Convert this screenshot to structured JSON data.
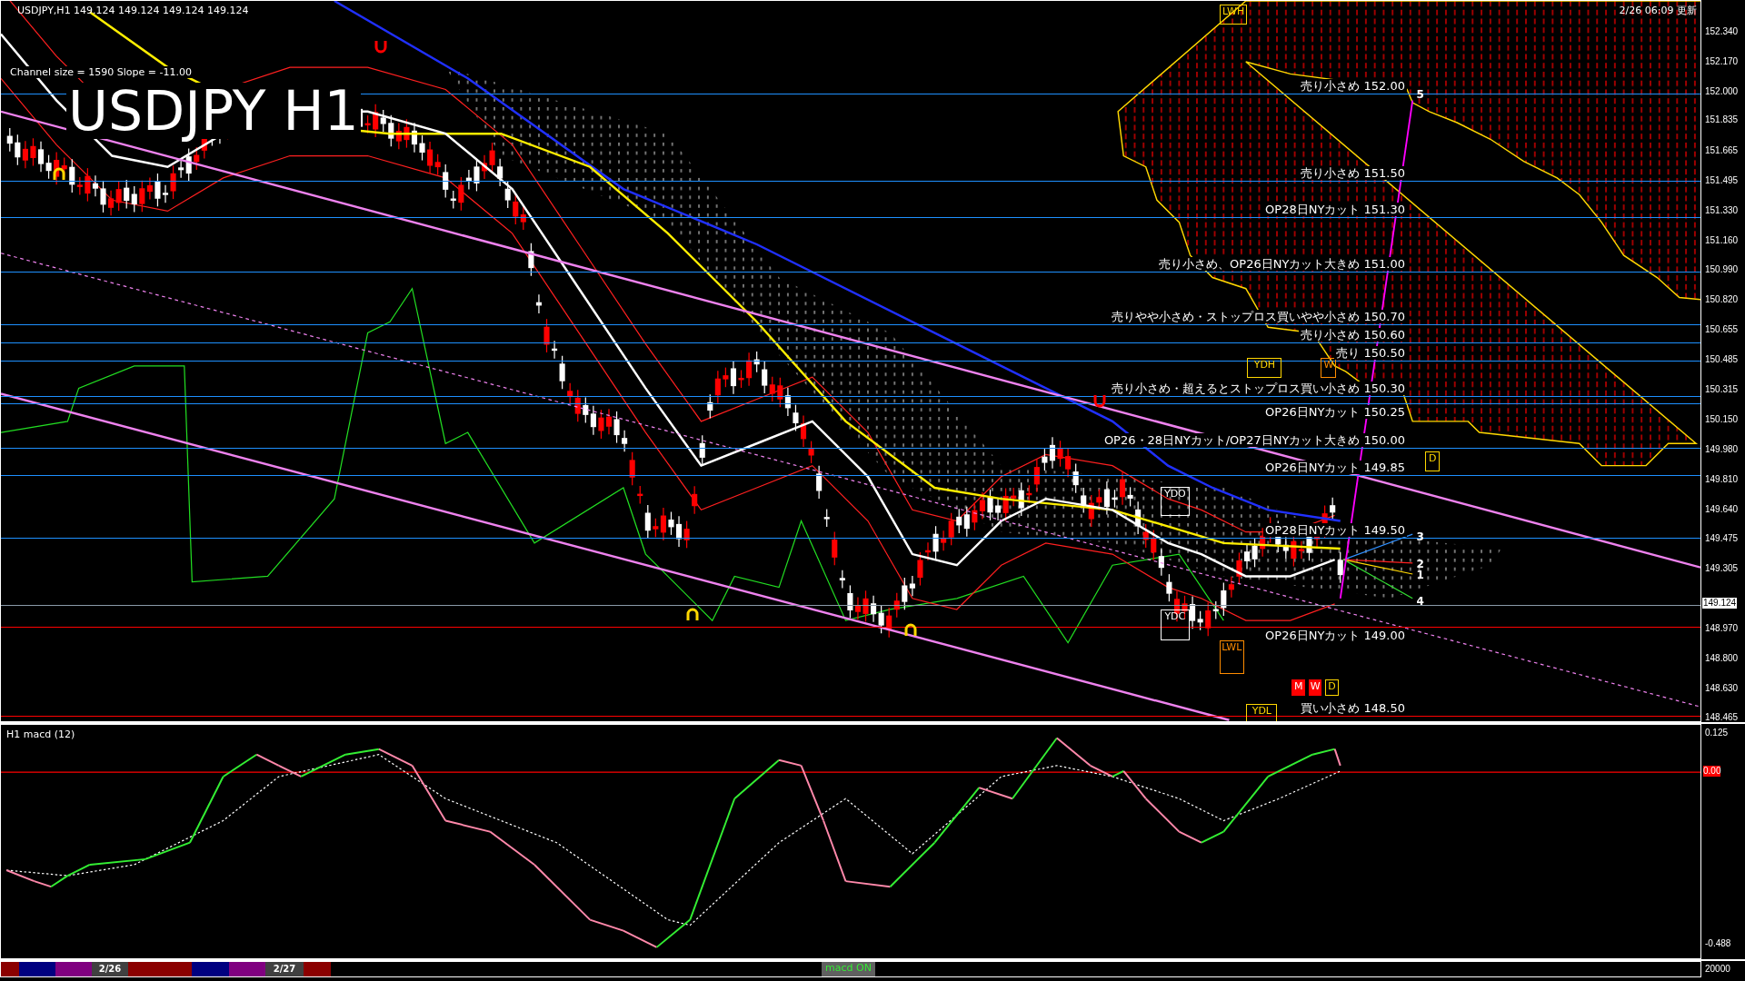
{
  "header": {
    "symbol_line": "USDJPY,H1  149.124 149.124 149.124 149.124",
    "updated": "2/26 06:09 更新",
    "channel_info": "Channel size = 1590 Slope = -11.00",
    "big_title": "USDJPY H1"
  },
  "levels": [
    {
      "label": "売り小さめ 152.00",
      "color": "#1e90ff"
    },
    {
      "label": "売り小さめ 151.50",
      "color": "#1e90ff"
    },
    {
      "label": "OP28日NYカット 151.30",
      "color": "#1e90ff"
    },
    {
      "label": "売り小さめ、OP26日NYカット大きめ 151.00",
      "color": "#1e90ff"
    },
    {
      "label": "売りやや小さめ・ストップロス買いやや小さめ 150.70",
      "color": "#1e90ff"
    },
    {
      "label": "売り小さめ 150.60",
      "color": "#1e90ff"
    },
    {
      "label": "売り 150.50",
      "color": "#1e90ff"
    },
    {
      "label": "売り小さめ・超えるとストップロス買い小さめ 150.30",
      "color": "#1e90ff"
    },
    {
      "label": "OP26日NYカット 150.25",
      "color": "#1e90ff"
    },
    {
      "label": "OP26・28日NYカット/OP27日NYカット大きめ 150.00",
      "color": "#1e90ff"
    },
    {
      "label": "OP26日NYカット 149.85",
      "color": "#1e90ff"
    },
    {
      "label": "OP28日NYカット 149.50",
      "color": "#1e90ff"
    },
    {
      "label": "OP26日NYカット 149.00",
      "color": "#ff0000"
    },
    {
      "label": "買い小さめ 148.50",
      "color": "#ff0000"
    }
  ],
  "markers": [
    {
      "label": "LWH",
      "color": "#ffd700"
    },
    {
      "label": "YDH",
      "color": "#ffd700"
    },
    {
      "label": "W",
      "color": "#ff8c00"
    },
    {
      "label": "D",
      "color": "#ffd700"
    },
    {
      "label": "YDO",
      "color": "#ffffff"
    },
    {
      "label": "YDC",
      "color": "#ffffff"
    },
    {
      "label": "LWL",
      "color": "#ff8c00"
    },
    {
      "label": "YDL",
      "color": "#ffd700"
    },
    {
      "label": "M",
      "color": "#ff0000"
    },
    {
      "label": "W",
      "color": "#ff0000"
    },
    {
      "label": "D",
      "color": "#ffd700"
    }
  ],
  "projections": [
    "5",
    "3",
    "2",
    "1",
    "4"
  ],
  "price_axis": [
    {
      "text": "152.340",
      "kind": "tick"
    },
    {
      "text": "152.170",
      "kind": "tick"
    },
    {
      "text": "152.000",
      "kind": "tick"
    },
    {
      "text": "151.835",
      "kind": "tick"
    },
    {
      "text": "151.665",
      "kind": "tick"
    },
    {
      "text": "151.495",
      "kind": "tick"
    },
    {
      "text": "151.330",
      "kind": "tick"
    },
    {
      "text": "151.160",
      "kind": "tick"
    },
    {
      "text": "150.990",
      "kind": "tick"
    },
    {
      "text": "150.820",
      "kind": "tick"
    },
    {
      "text": "150.655",
      "kind": "tick"
    },
    {
      "text": "150.485",
      "kind": "tick"
    },
    {
      "text": "150.315",
      "kind": "tick"
    },
    {
      "text": "150.150",
      "kind": "tick"
    },
    {
      "text": "149.980",
      "kind": "tick"
    },
    {
      "text": "149.810",
      "kind": "tick"
    },
    {
      "text": "149.640",
      "kind": "tick"
    },
    {
      "text": "149.475",
      "kind": "tick"
    },
    {
      "text": "149.305",
      "kind": "tick"
    },
    {
      "text": "149.124",
      "kind": "current"
    },
    {
      "text": "148.970",
      "kind": "tick"
    },
    {
      "text": "148.800",
      "kind": "tick"
    },
    {
      "text": "148.630",
      "kind": "tick"
    },
    {
      "text": "148.465",
      "kind": "tick"
    }
  ],
  "macd": {
    "title": "H1  macd (12)",
    "axis": [
      {
        "text": "0.125",
        "kind": "tick"
      },
      {
        "text": "0.00",
        "kind": "zero"
      },
      {
        "text": "-0.488",
        "kind": "tick"
      }
    ]
  },
  "bottom_bar": {
    "segments": [
      {
        "color": "#8b0000"
      },
      {
        "color": "#000080"
      },
      {
        "color": "#800080"
      },
      {
        "color": "#404040",
        "label": "2/26"
      },
      {
        "color": "#8b0000"
      },
      {
        "color": "#000080"
      },
      {
        "color": "#800080"
      },
      {
        "color": "#404040",
        "label": "2/27"
      },
      {
        "color": "#8b0000"
      }
    ],
    "toggle": "macd ON",
    "volume_scale": "20000"
  }
}
